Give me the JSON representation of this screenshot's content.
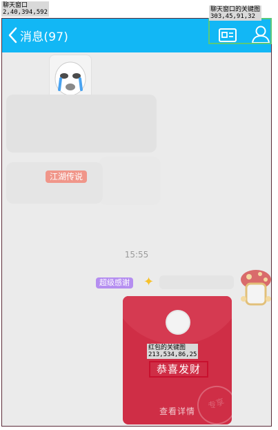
{
  "chat": {
    "back_label": "消息(97)",
    "jianghu_tag": "江湖传说",
    "timestamp": "15:55",
    "chaoji_tag": "超级感谢"
  },
  "red_packet": {
    "greeting": "恭喜发财",
    "details": "查看详情",
    "stamp": "专享"
  },
  "annotations": {
    "chat_window": {
      "title": "聊天窗口",
      "coords": "2,40,394,592",
      "color": "#5a2a37"
    },
    "chat_key_image": {
      "title": "聊天窗口的关键图",
      "coords": "303,45,91,32",
      "color": "#59c97a"
    },
    "red_packet_key_image": {
      "title": "红包的关键图",
      "coords": "213,534,86,25",
      "color": "#c8102e"
    }
  },
  "colors": {
    "topbar": "#12b7f5",
    "chat_bg": "#ebebeb",
    "red_packet": "#cf2e46"
  }
}
